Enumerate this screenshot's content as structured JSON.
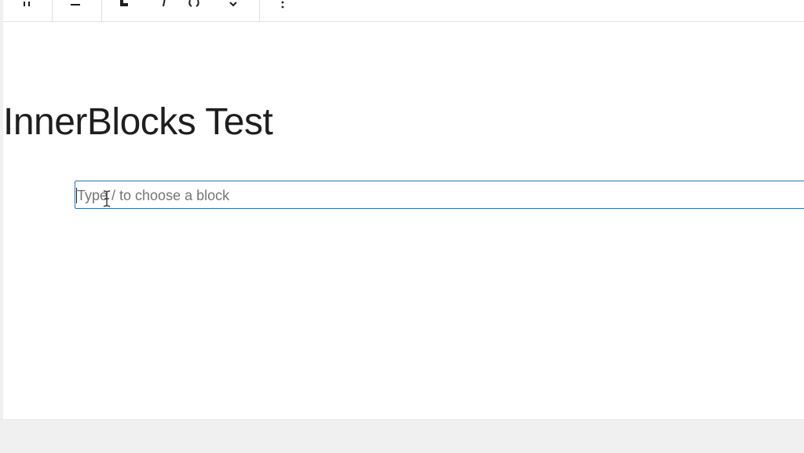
{
  "toolbar": {
    "groups": [
      {
        "name": "block-mover",
        "icon": "drag-handle-icon"
      },
      {
        "name": "align",
        "icon": "align-icon"
      },
      {
        "name": "formatting",
        "icons": [
          "bold-icon",
          "italic-icon",
          "link-icon",
          "chevron-down-icon"
        ]
      },
      {
        "name": "more",
        "icon": "more-options-icon"
      }
    ]
  },
  "post": {
    "title": "InnerBlocks Test"
  },
  "appender": {
    "placeholder": "Type / to choose a block"
  },
  "colors": {
    "accent": "#2c6fa8",
    "text": "#1e1e1e",
    "placeholder": "#757575",
    "background": "#f0f0f1"
  }
}
